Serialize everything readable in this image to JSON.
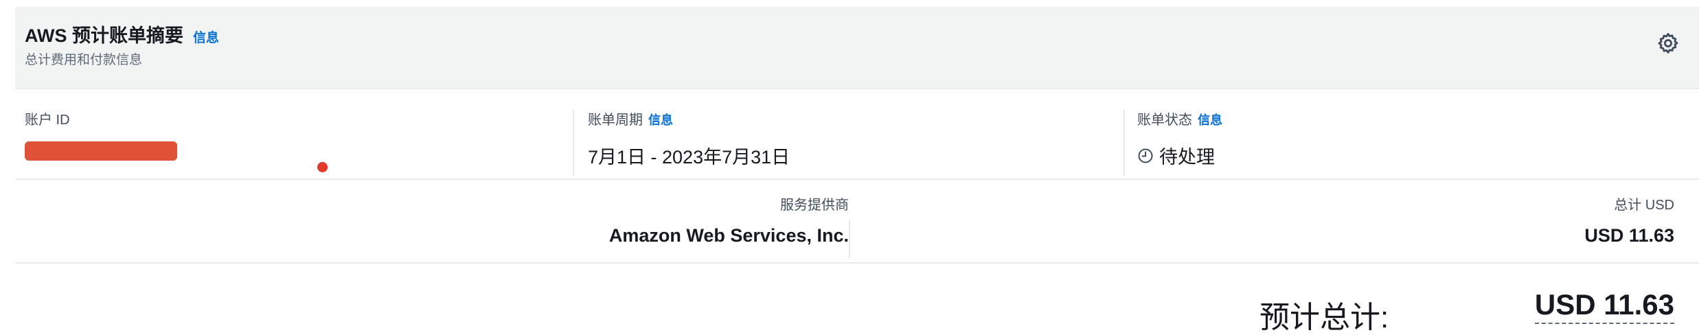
{
  "header": {
    "title": "AWS 预计账单摘要",
    "info": "信息",
    "subtitle": "总计费用和付款信息",
    "settings_icon": "gear-icon"
  },
  "account": {
    "label": "账户 ID"
  },
  "billing_period": {
    "label": "账单周期",
    "info": "信息",
    "value": "7月1日 - 2023年7月31日"
  },
  "billing_status": {
    "label": "账单状态",
    "info": "信息",
    "icon": "clock-icon",
    "value": "待处理"
  },
  "provider": {
    "label": "服务提供商",
    "value": "Amazon Web Services, Inc."
  },
  "total": {
    "label": "总计 USD",
    "value": "USD 11.63"
  },
  "estimated_total": {
    "label": "预计总计:",
    "value": "USD 11.63"
  },
  "colors": {
    "link": "#0972d3",
    "header_bg": "#f2f3f3",
    "redaction": "#df5238"
  }
}
